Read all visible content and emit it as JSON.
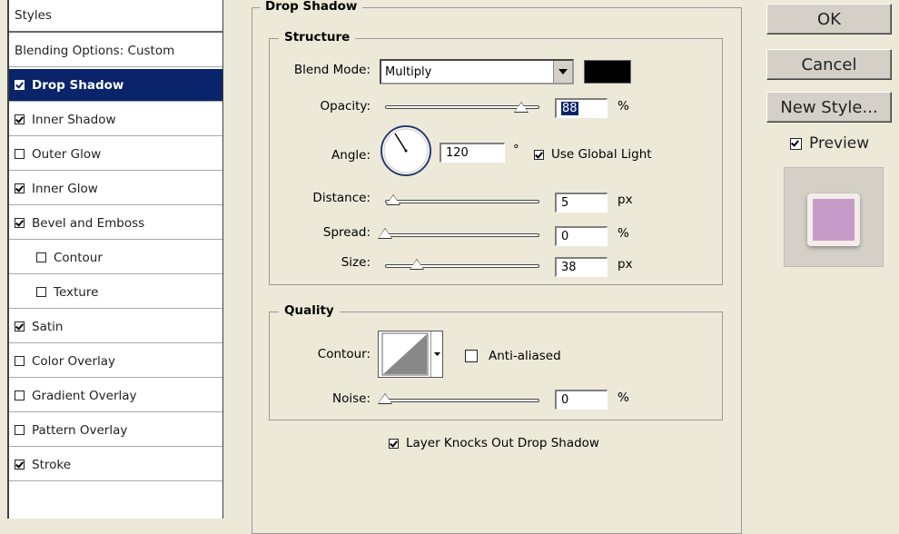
{
  "styles_list": {
    "header": "Styles",
    "items": [
      {
        "label": "Blending Options: Custom",
        "has_checkbox": false,
        "checked": false,
        "indent": false,
        "selected": false
      },
      {
        "label": "Drop Shadow",
        "has_checkbox": true,
        "checked": true,
        "indent": false,
        "selected": true
      },
      {
        "label": "Inner Shadow",
        "has_checkbox": true,
        "checked": true,
        "indent": false,
        "selected": false
      },
      {
        "label": "Outer Glow",
        "has_checkbox": true,
        "checked": false,
        "indent": false,
        "selected": false
      },
      {
        "label": "Inner Glow",
        "has_checkbox": true,
        "checked": true,
        "indent": false,
        "selected": false
      },
      {
        "label": "Bevel and Emboss",
        "has_checkbox": true,
        "checked": true,
        "indent": false,
        "selected": false
      },
      {
        "label": "Contour",
        "has_checkbox": true,
        "checked": false,
        "indent": true,
        "selected": false
      },
      {
        "label": "Texture",
        "has_checkbox": true,
        "checked": false,
        "indent": true,
        "selected": false
      },
      {
        "label": "Satin",
        "has_checkbox": true,
        "checked": true,
        "indent": false,
        "selected": false
      },
      {
        "label": "Color Overlay",
        "has_checkbox": true,
        "checked": false,
        "indent": false,
        "selected": false
      },
      {
        "label": "Gradient Overlay",
        "has_checkbox": true,
        "checked": false,
        "indent": false,
        "selected": false
      },
      {
        "label": "Pattern Overlay",
        "has_checkbox": true,
        "checked": false,
        "indent": false,
        "selected": false
      },
      {
        "label": "Stroke",
        "has_checkbox": true,
        "checked": true,
        "indent": false,
        "selected": false
      }
    ]
  },
  "drop_shadow": {
    "title": "Drop Shadow",
    "structure": {
      "title": "Structure",
      "blend_mode_label": "Blend Mode:",
      "blend_mode_value": "Multiply",
      "shadow_color": "#000000",
      "opacity_label": "Opacity:",
      "opacity_value": "88",
      "opacity_unit": "%",
      "opacity_level": 0.88,
      "angle_label": "Angle:",
      "angle_value": "120",
      "angle_unit": "°",
      "use_global_light_label": "Use Global Light",
      "use_global_light_checked": true,
      "distance_label": "Distance:",
      "distance_value": "5",
      "distance_unit": "px",
      "spread_label": "Spread:",
      "spread_value": "0",
      "spread_unit": "%",
      "size_label": "Size:",
      "size_value": "38",
      "size_unit": "px"
    },
    "quality": {
      "title": "Quality",
      "contour_label": "Contour:",
      "anti_aliased_label": "Anti-aliased",
      "anti_aliased_checked": false,
      "noise_label": "Noise:",
      "noise_value": "0",
      "noise_unit": "%"
    },
    "knockout_label": "Layer Knocks Out Drop Shadow",
    "knockout_checked": true
  },
  "buttons": {
    "ok": "OK",
    "cancel": "Cancel",
    "new_style": "New Style..."
  },
  "preview": {
    "label": "Preview",
    "checked": true,
    "swatch_color": "#c79bc8"
  }
}
